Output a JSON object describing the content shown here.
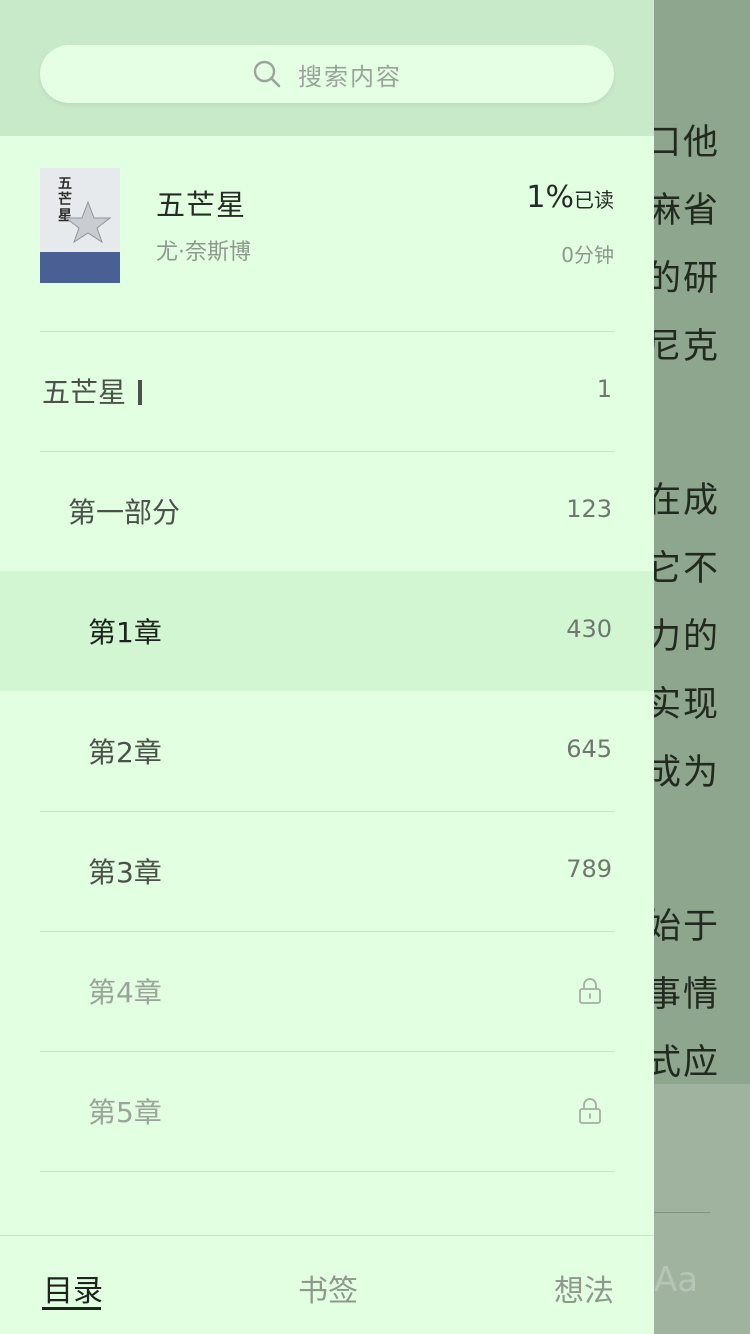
{
  "search": {
    "placeholder": "搜索内容",
    "icon": "search-icon"
  },
  "book": {
    "title": "五芒星",
    "author": "尤·奈斯博",
    "progress_value": "1%",
    "progress_suffix": "已读",
    "reading_time": "0分钟",
    "cover_title": "五芒星"
  },
  "toc": [
    {
      "label": "五芒星",
      "page": "1",
      "level": 0,
      "current": true
    },
    {
      "label": "第一部分",
      "page": "123",
      "level": 1
    },
    {
      "label": "第1章",
      "page": "430",
      "level": 2,
      "active": true
    },
    {
      "label": "第2章",
      "page": "645",
      "level": 2
    },
    {
      "label": "第3章",
      "page": "789",
      "level": 2
    },
    {
      "label": "第4章",
      "locked": true,
      "level": 2
    },
    {
      "label": "第5章",
      "locked": true,
      "level": 2
    }
  ],
  "tabs": [
    {
      "label": "目录",
      "active": true
    },
    {
      "label": "书签"
    },
    {
      "label": "想法"
    }
  ],
  "reader_background": {
    "lines": [
      "口他",
      "麻省",
      "的研",
      "尼克",
      "在成",
      "它不",
      "力的",
      "实现",
      "成为",
      "始于",
      "事情",
      "式应"
    ],
    "font_button": "Aa"
  },
  "colors": {
    "drawer_bg": "#e2ffe2",
    "header_bg": "#c9eac9",
    "active_row_bg": "#d2f6d2",
    "reader_bg": "#8da68d"
  }
}
